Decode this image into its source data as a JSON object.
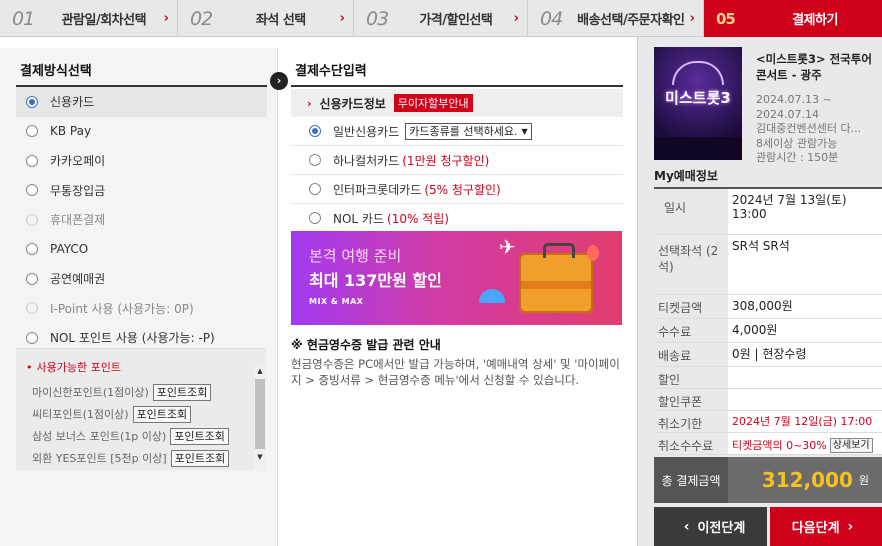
{
  "steps": [
    {
      "num": "01",
      "label": "관람일/회차선택"
    },
    {
      "num": "02",
      "label": "좌석 선택"
    },
    {
      "num": "03",
      "label": "가격/할인선택"
    },
    {
      "num": "04",
      "label": "배송선택/주문자확인"
    },
    {
      "num": "05",
      "label": "결제하기"
    }
  ],
  "payment_methods": {
    "title": "결제방식선택",
    "items": [
      {
        "label": "신용카드",
        "selected": true
      },
      {
        "label": "KB Pay"
      },
      {
        "label": "카카오페이"
      },
      {
        "label": "무통장입금"
      },
      {
        "label": "휴대폰결제",
        "disabled": true
      },
      {
        "label": "PAYCO"
      },
      {
        "label": "공연예매권"
      },
      {
        "label": "I-Point 사용 (사용가능: 0P)",
        "disabled": true
      },
      {
        "label": "NOL 포인트 사용 (사용가능: -P)"
      }
    ]
  },
  "points": {
    "title": "사용가능한 포인트",
    "items": [
      {
        "label": "마이신한포인트(1점이상)",
        "button": "포인트조회"
      },
      {
        "label": "씨티포인트(1점이상)",
        "button": "포인트조회"
      },
      {
        "label": "삼성 보너스 포인트(1p 이상)",
        "button": "포인트조회"
      },
      {
        "label": "외환 YES포인트 [5천p 이상]",
        "button": "포인트조회"
      }
    ]
  },
  "payment_input": {
    "title": "결제수단입력",
    "card_head": "신용카드정보",
    "badge": "무이자할부안내",
    "cards": [
      {
        "label": "일반신용카드",
        "select": "카드종류를 선택하세요.",
        "selected": true
      },
      {
        "label": "하나컬처카드",
        "promo": "(1만원 청구할인)"
      },
      {
        "label": "인터파크롯데카드",
        "promo": "(5% 청구할인)"
      },
      {
        "label": "NOL 카드",
        "promo": "(10% 적립)"
      }
    ],
    "banner": {
      "line1": "본격 여행 준비",
      "line2": "최대 137만원 할인",
      "line3": "MIX & MAX"
    },
    "cash_title": "※ 현금영수증 발급 관련 안내",
    "cash_desc": "현금영수증은 PC에서만 발급 가능하며, '예매내역 상세' 및 '마이페이지 > 증빙서류 > 현금영수증 메뉴'에서 신청할 수 있습니다."
  },
  "show": {
    "poster_text": "미스트롯3",
    "title": "<미스트롯3> 전국투어 콘서트 - 광주",
    "dates": "2024.07.13 ~ 2024.07.14",
    "venue": "김대중컨벤션센터 다...",
    "age": "8세이상 관람가능",
    "runtime": "관람시간 : 150분"
  },
  "reservation": {
    "title": "My예매정보",
    "rows": [
      {
        "k": "일시",
        "v": "2024년 7월 13일(토) 13:00"
      },
      {
        "k": "선택좌석 (2석)",
        "v": "SR석 SR석"
      },
      {
        "k": "티켓금액",
        "v": "308,000원"
      },
      {
        "k": "수수료",
        "v": "4,000원"
      },
      {
        "k": "배송료",
        "v": "0원 | 현장수령"
      },
      {
        "k": "할인",
        "v": ""
      },
      {
        "k": "할인쿠폰",
        "v": ""
      },
      {
        "k": "취소기한",
        "v": "2024년 7월 12일(금) 17:00"
      },
      {
        "k": "취소수수료",
        "v": "티켓금액의 0~30%",
        "button": "상세보기"
      }
    ],
    "total_label": "총 결제금액",
    "total_amount": "312,000",
    "total_unit": "원"
  },
  "buttons": {
    "prev": "이전단계",
    "next": "다음단계"
  }
}
